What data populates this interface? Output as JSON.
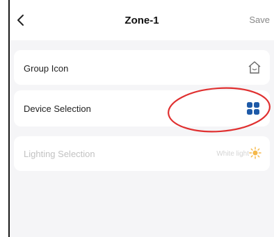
{
  "header": {
    "title": "Zone-1",
    "save_label": "Save"
  },
  "rows": {
    "group_icon": {
      "label": "Group Icon",
      "icon": "home-icon"
    },
    "device_selection": {
      "label": "Device Selection",
      "icon": "grid-icon",
      "accent": "#1e5aa8"
    },
    "lighting_selection": {
      "label": "Lighting Selection",
      "value": "White light",
      "icon": "sun-icon",
      "enabled": false
    }
  },
  "annotation": {
    "shape": "ellipse",
    "color": "#e03030"
  }
}
